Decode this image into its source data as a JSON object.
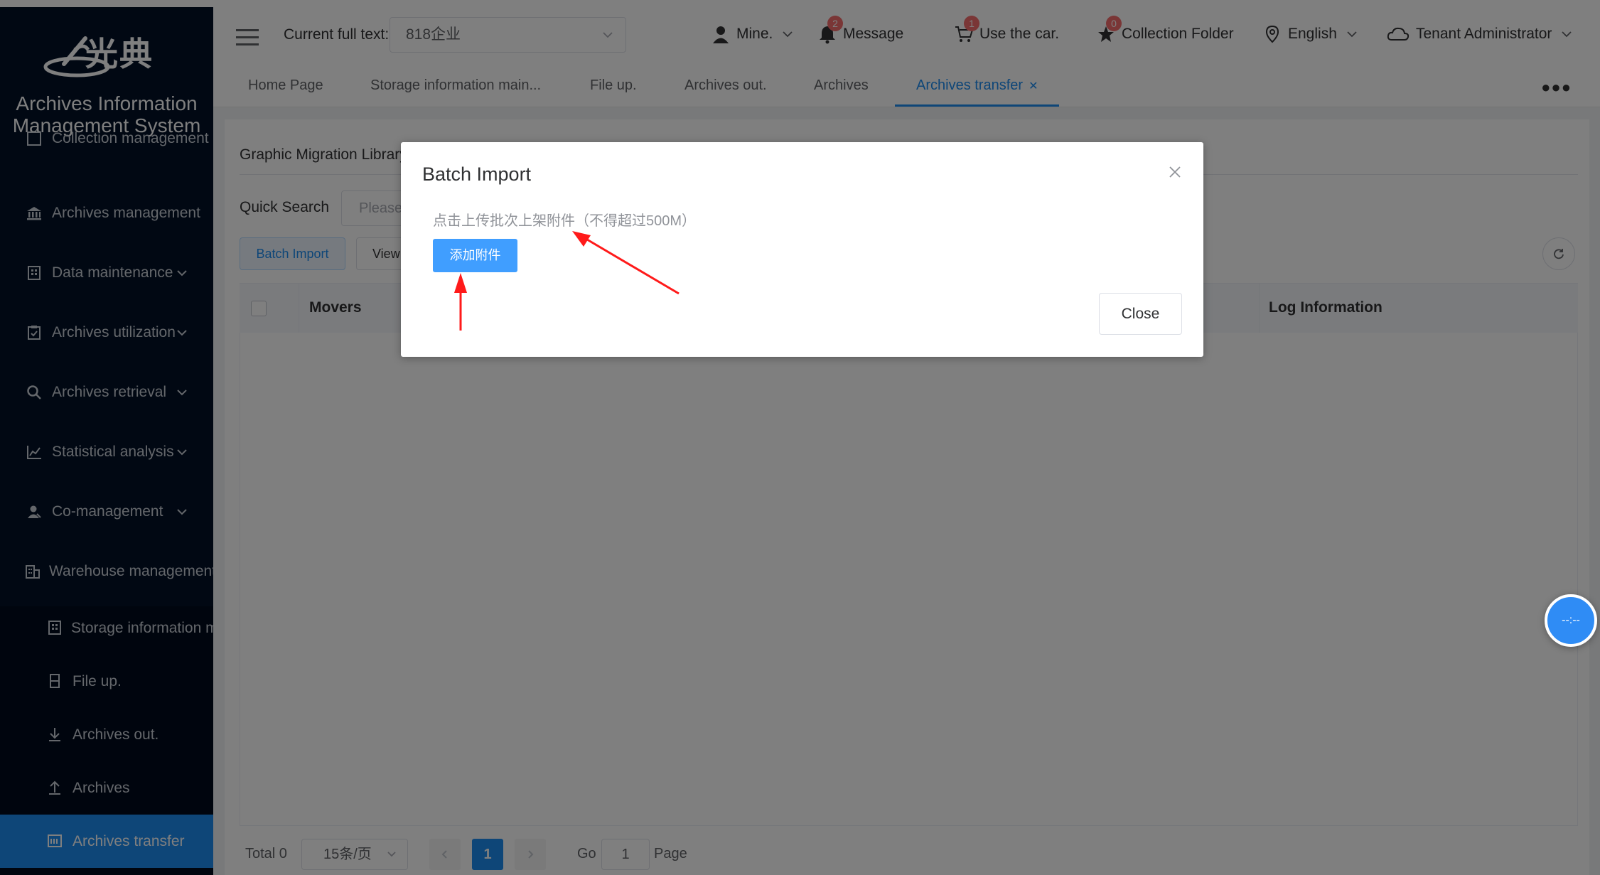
{
  "sidebar": {
    "logo_text": "光典",
    "system_title_line1": "Archives Information",
    "system_title_line2": "Management System",
    "items": [
      {
        "label": "Collection management"
      },
      {
        "label": "Archives management"
      },
      {
        "label": "Data maintenance"
      },
      {
        "label": "Archives utilization"
      },
      {
        "label": "Archives retrieval"
      },
      {
        "label": "Statistical analysis"
      },
      {
        "label": "Co-management"
      },
      {
        "label": "Warehouse management"
      }
    ],
    "sub_items": [
      {
        "label": "Storage information maintenance"
      },
      {
        "label": "File up."
      },
      {
        "label": "Archives out."
      },
      {
        "label": "Archives"
      },
      {
        "label": "Archives transfer"
      }
    ]
  },
  "header": {
    "current_full_text_label": "Current full text:",
    "current_full_text_value": "818企业",
    "mine_label": "Mine.",
    "message_label": "Message",
    "message_badge": "2",
    "car_label": "Use the car.",
    "car_badge": "1",
    "collection_label": "Collection Folder",
    "collection_badge": "0",
    "language_label": "English",
    "tenant_label": "Tenant Administrator"
  },
  "tabs": [
    {
      "label": "Home Page"
    },
    {
      "label": "Storage information main..."
    },
    {
      "label": "File up."
    },
    {
      "label": "Archives out."
    },
    {
      "label": "Archives"
    },
    {
      "label": "Archives transfer",
      "active": true
    }
  ],
  "main": {
    "library_title": "Graphic Migration Library",
    "quick_search_label": "Quick Search",
    "quick_search_placeholder": "Please",
    "batch_import_label": "Batch Import",
    "view_label": "View",
    "columns": [
      "Movers",
      "Log Information"
    ]
  },
  "pagination": {
    "total_label": "Total 0",
    "page_size_label": "15条/页",
    "current_page": "1",
    "go_label": "Go",
    "go_value": "1",
    "page_label": "Page"
  },
  "float_button": {
    "text": "--:--"
  },
  "dialog": {
    "title": "Batch Import",
    "tip": "点击上传批次上架附件（不得超过500M）",
    "add_attachment_label": "添加附件",
    "close_label": "Close"
  },
  "colors": {
    "primary": "#1d8cf0",
    "sidebar_bg": "#021026",
    "annotation_arrow": "#ff1a1a",
    "badge": "#f56c6c"
  }
}
